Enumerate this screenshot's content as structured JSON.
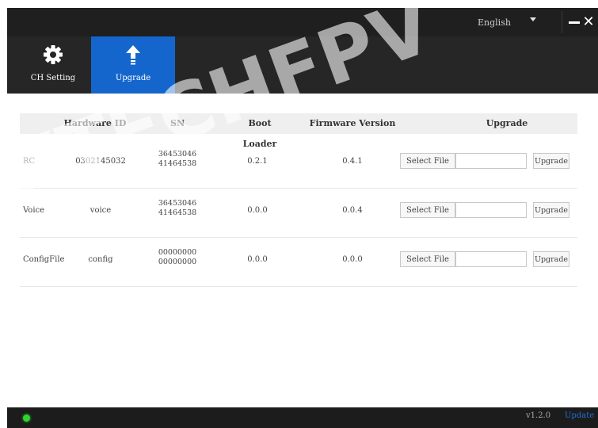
{
  "titlebar": {
    "language": "English",
    "minimize_label": "−",
    "close_label": "✕"
  },
  "nav": {
    "tabs": [
      {
        "label": "CH Setting",
        "icon": "gear-icon"
      },
      {
        "label": "Upgrade",
        "icon": "upload-arrow-icon",
        "active": true
      }
    ]
  },
  "table": {
    "headers": [
      "Hardware ID",
      "SN",
      "Boot Loader",
      "Firmware Version",
      "Upgrade"
    ],
    "rows": [
      {
        "name": "RC",
        "hardware_id": "0302145032",
        "sn_line1": "36453046",
        "sn_line2": "41464538",
        "boot_loader": "0.2.1",
        "firmware": "0.4.1",
        "select_label": "Select File",
        "upgrade_label": "Upgrade"
      },
      {
        "name": "Voice",
        "hardware_id": "voice",
        "sn_line1": "36453046",
        "sn_line2": "41464538",
        "boot_loader": "0.0.0",
        "firmware": "0.0.4",
        "select_label": "Select File",
        "upgrade_label": "Upgrade"
      },
      {
        "name": "ConfigFile",
        "hardware_id": "config",
        "sn_line1": "00000000",
        "sn_line2": "00000000",
        "boot_loader": "0.0.0",
        "firmware": "0.0.0",
        "select_label": "Select File",
        "upgrade_label": "Upgrade"
      }
    ]
  },
  "status": {
    "version": "v1.2.0",
    "update_label": "Update",
    "led_color": "#2ed52e"
  },
  "colors": {
    "accent": "#1566cc",
    "titlebar": "#1f1f1f"
  },
  "watermark": "XTECHFPV"
}
